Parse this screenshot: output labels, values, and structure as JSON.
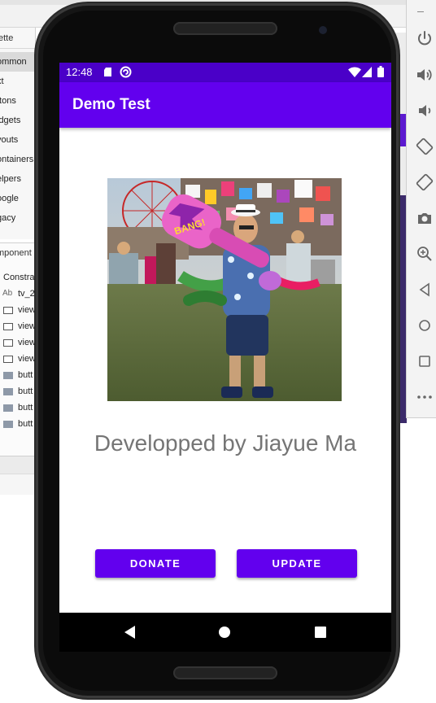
{
  "ide": {
    "palette_title": "ette",
    "palette_items": [
      "ommon",
      "xt",
      "ttons",
      "idgets",
      "youts",
      "ontainers",
      "elpers",
      "oogle",
      "gacy"
    ],
    "selected_index": 0,
    "tree_title": "mponent",
    "tree_rows": [
      {
        "label": "Constra",
        "icon": "none"
      },
      {
        "label": "tv_2",
        "icon": "text-view-icon"
      },
      {
        "label": "view",
        "icon": "view-icon"
      },
      {
        "label": "view",
        "icon": "view-icon"
      },
      {
        "label": "view",
        "icon": "view-icon"
      },
      {
        "label": "view",
        "icon": "view-icon"
      },
      {
        "label": "butt",
        "icon": "button-icon"
      },
      {
        "label": "butt",
        "icon": "button-icon"
      },
      {
        "label": "butt",
        "icon": "button-icon"
      },
      {
        "label": "butt",
        "icon": "button-icon"
      }
    ],
    "tree_ab": "Ab"
  },
  "emulator_toolbar": {
    "icons": [
      "power-icon",
      "volume-up-icon",
      "volume-down-icon",
      "rotate-left-icon",
      "rotate-right-icon",
      "camera-icon",
      "zoom-icon",
      "back-icon",
      "home-icon",
      "overview-icon",
      "more-icon"
    ]
  },
  "status_bar": {
    "time": "12:48",
    "icons": [
      "sd-card-icon",
      "sync-icon",
      "wifi-icon",
      "signal-icon",
      "battery-icon"
    ]
  },
  "app": {
    "title": "Demo Test",
    "credit": "Developped by Jiayue Ma",
    "donate_label": "DONATE",
    "update_label": "UPDATE",
    "photo_sign_text": "BANG!",
    "accent_color": "#6200ee",
    "status_color": "#4a00c8"
  },
  "nav_bar": {
    "icons": [
      "nav-back-icon",
      "nav-home-icon",
      "nav-recents-icon"
    ]
  }
}
